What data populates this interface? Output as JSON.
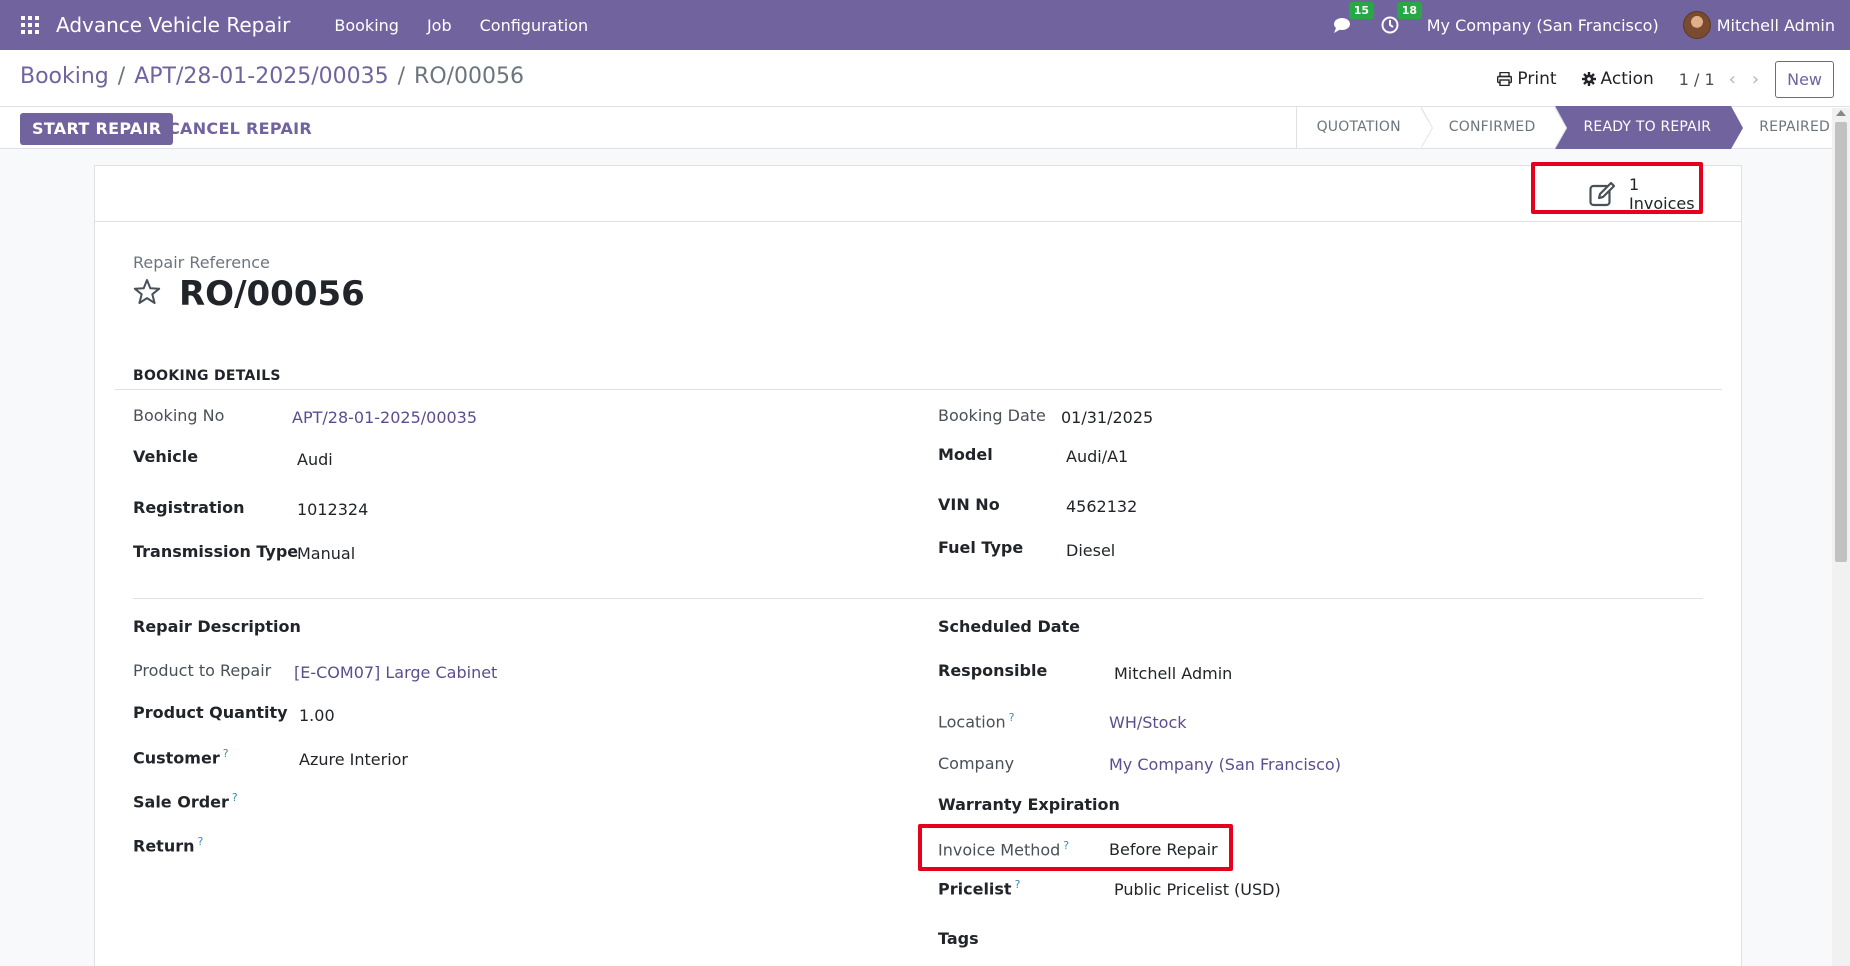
{
  "navbar": {
    "app_name": "Advance Vehicle Repair",
    "menu": [
      "Booking",
      "Job",
      "Configuration"
    ],
    "messages_count": "15",
    "activities_count": "18",
    "company": "My Company (San Francisco)",
    "user": "Mitchell Admin"
  },
  "breadcrumb": {
    "root": "Booking",
    "parent": "APT/28-01-2025/00035",
    "current": "RO/00056",
    "separator": "/"
  },
  "control": {
    "print_label": "Print",
    "action_label": "Action",
    "pager": "1 / 1",
    "new_label": "New",
    "start_repair": "START REPAIR",
    "cancel_repair": "CANCEL REPAIR"
  },
  "statusbar": {
    "stages": [
      "QUOTATION",
      "CONFIRMED",
      "READY TO REPAIR",
      "REPAIRED"
    ],
    "active": "READY TO REPAIR"
  },
  "smart_button": {
    "count": "1",
    "label": "Invoices"
  },
  "record": {
    "ref_label": "Repair Reference",
    "ref_value": "RO/00056"
  },
  "booking_details": {
    "title": "BOOKING DETAILS",
    "booking_no_label": "Booking No",
    "booking_no": "APT/28-01-2025/00035",
    "vehicle_label": "Vehicle",
    "vehicle": "Audi",
    "registration_label": "Registration",
    "registration": "1012324",
    "transmission_label": "Transmission Type",
    "transmission": "Manual",
    "booking_date_label": "Booking Date",
    "booking_date": "01/31/2025",
    "model_label": "Model",
    "model": "Audi/A1",
    "vin_label": "VIN No",
    "vin": "4562132",
    "fuel_label": "Fuel Type",
    "fuel": "Diesel"
  },
  "repair": {
    "description_label": "Repair Description",
    "product_label": "Product to Repair",
    "product": "[E-COM07] Large Cabinet",
    "quantity_label": "Product Quantity",
    "quantity": "1.00",
    "customer_label": "Customer",
    "customer": "Azure Interior",
    "sale_order_label": "Sale Order",
    "return_label": "Return",
    "scheduled_label": "Scheduled Date",
    "responsible_label": "Responsible",
    "responsible": "Mitchell Admin",
    "location_label": "Location",
    "location": "WH/Stock",
    "company_label": "Company",
    "company": "My Company (San Francisco)",
    "warranty_label": "Warranty Expiration",
    "invoice_method_label": "Invoice Method",
    "invoice_method": "Before Repair",
    "pricelist_label": "Pricelist",
    "pricelist": "Public Pricelist (USD)",
    "tags_label": "Tags",
    "help_mark": "?"
  }
}
